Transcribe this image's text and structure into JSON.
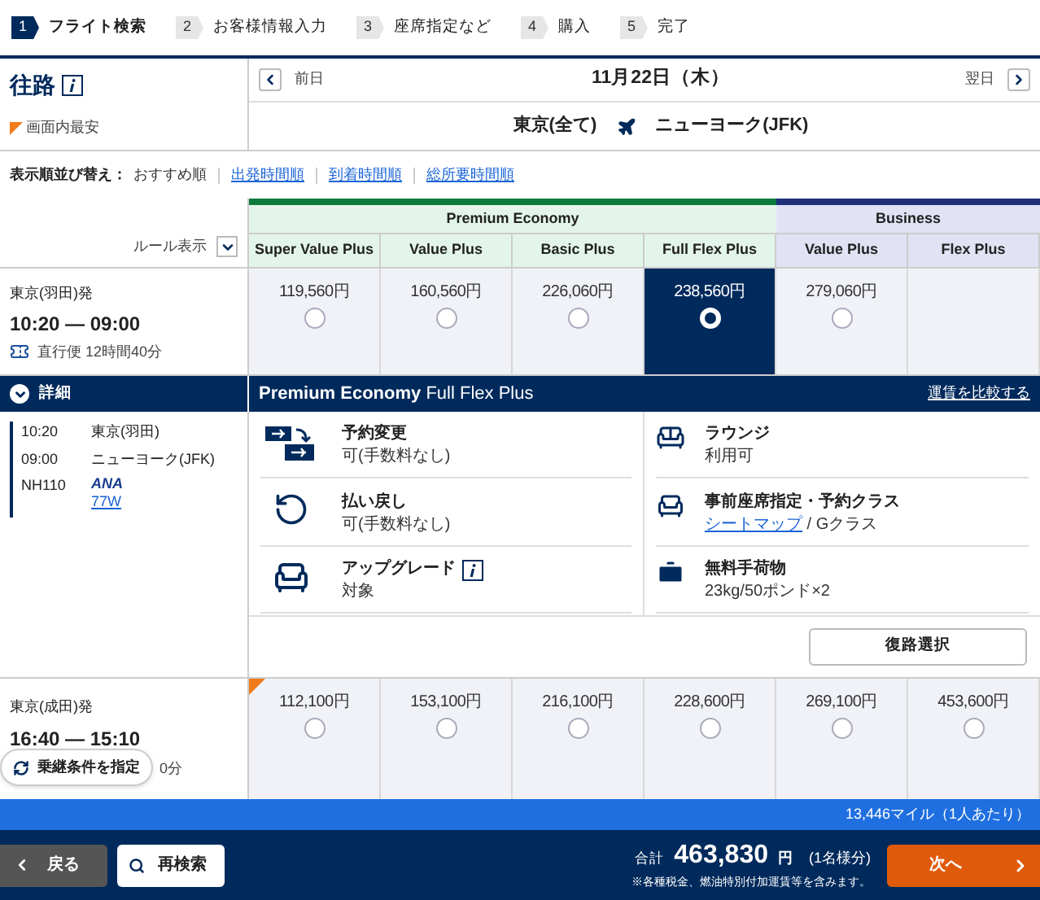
{
  "steps": [
    {
      "number": "1",
      "label": "フライト検索",
      "selected": true
    },
    {
      "number": "2",
      "label": "お客様情報入力",
      "selected": false
    },
    {
      "number": "3",
      "label": "座席指定など",
      "selected": false
    },
    {
      "number": "4",
      "label": "購入",
      "selected": false
    },
    {
      "number": "5",
      "label": "完了",
      "selected": false
    }
  ],
  "outbound": {
    "title": "往路",
    "legend": "画面内最安",
    "prev": "前日",
    "date": "11月22日（木）",
    "next": "翌日",
    "from": "東京(全て)",
    "to": "ニューヨーク(JFK)"
  },
  "sort": {
    "label": "表示順並び替え：",
    "options": [
      {
        "label": "おすすめ順",
        "selected": true
      },
      {
        "label": "出発時間順",
        "selected": false
      },
      {
        "label": "到着時間順",
        "selected": false
      },
      {
        "label": "総所要時間順",
        "selected": false
      }
    ]
  },
  "rule_toggle": "ルール表示",
  "fare_groups": [
    {
      "name": "Premium Economy",
      "color": "#0b7a3b",
      "columns": [
        "Super Value Plus",
        "Value Plus",
        "Basic Plus",
        "Full Flex Plus"
      ]
    },
    {
      "name": "Business",
      "color": "#1f2f7a",
      "columns": [
        "Value Plus",
        "Flex Plus"
      ]
    }
  ],
  "flights": [
    {
      "departure": "東京(羽田)発",
      "times": "10:20 — 09:00",
      "duration": "直行便 12時間40分",
      "cheapest": false,
      "expanded": true,
      "fares": [
        {
          "price": "119,560円",
          "selected": false
        },
        {
          "price": "160,560円",
          "selected": false
        },
        {
          "price": "226,060円",
          "selected": false
        },
        {
          "price": "238,560円",
          "selected": true
        },
        {
          "price": "279,060円",
          "selected": false
        }
      ]
    },
    {
      "departure": "東京(成田)発",
      "times": "16:40 — 15:10",
      "duration": "0分",
      "cheapest": true,
      "fares": [
        {
          "price": "112,100円",
          "selected": false
        },
        {
          "price": "153,100円",
          "selected": false
        },
        {
          "price": "216,100円",
          "selected": false
        },
        {
          "price": "228,600円",
          "selected": false
        },
        {
          "price": "269,100円",
          "selected": false
        },
        {
          "price": "453,600円",
          "selected": false
        }
      ]
    }
  ],
  "details": {
    "label": "詳細",
    "title": "**Premium Economy** Full Flex Plus",
    "compare": "運賃を比較する",
    "segment": [
      {
        "time": "10:20",
        "place": "東京(羽田)"
      },
      {
        "time": "09:00",
        "place": "ニューヨーク(JFK)"
      }
    ],
    "flight_number": "NH110",
    "airline": "ANA",
    "aircraft": "77W",
    "benefits": [
      {
        "kind": "change",
        "title": "予約変更",
        "value": "可(手数料なし)"
      },
      {
        "kind": "lounge",
        "title": "ラウンジ",
        "value": "利用可"
      },
      {
        "kind": "refund",
        "title": "払い戻し",
        "value": "可(手数料なし)"
      },
      {
        "kind": "seat",
        "title": "事前座席指定・予約クラス",
        "link": "シートマップ",
        "value": " / Gクラス"
      },
      {
        "kind": "upgrade",
        "title": "アップグレード",
        "value": "対象",
        "info": true
      },
      {
        "kind": "baggage",
        "title": "無料手荷物",
        "value": "23kg/50ポンド×2"
      }
    ],
    "return_button": "復路選択"
  },
  "connection_button": "乗継条件を指定",
  "miles": "13,446マイル（1人あたり）",
  "footer": {
    "back": "戻る",
    "search": "再検索",
    "total_label": "合計",
    "amount": "463,830",
    "unit": "円",
    "per": "(1名様分)",
    "note": "※各種税金、燃油特別付加運賃等を含みます。",
    "next": "次へ"
  }
}
